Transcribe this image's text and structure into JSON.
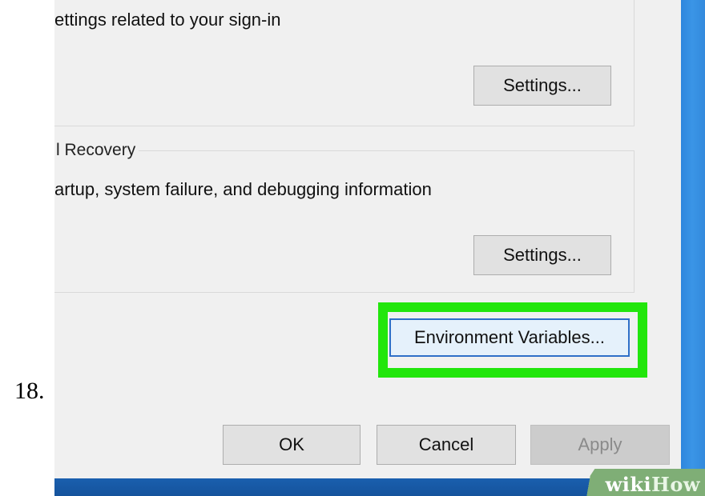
{
  "step": {
    "number": "18."
  },
  "dialog": {
    "user_profiles": {
      "description": "ettings related to your sign-in",
      "settings_label": "Settings..."
    },
    "startup_recovery": {
      "legend": "l Recovery",
      "description": "artup, system failure, and debugging information",
      "settings_label": "Settings..."
    },
    "environment_variables_label": "Environment Variables...",
    "footer": {
      "ok_label": "OK",
      "cancel_label": "Cancel",
      "apply_label": "Apply"
    }
  },
  "watermark": {
    "part1": "wiki",
    "part2": "How"
  },
  "colors": {
    "highlight": "#22e60c",
    "dialog_bg": "#f0f0f0",
    "desktop": "#1f6cc0",
    "button_bg": "#e1e1e1"
  }
}
